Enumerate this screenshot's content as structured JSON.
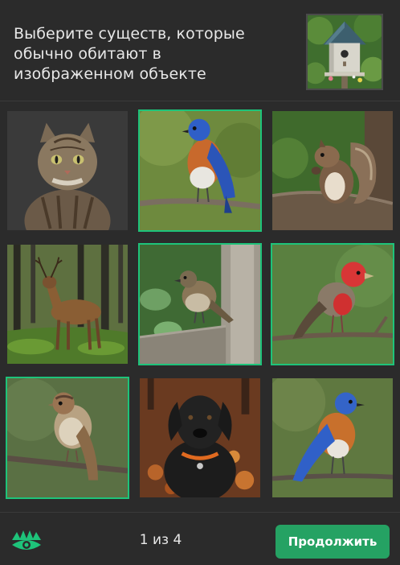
{
  "prompt": {
    "text": "Выберите существ, которые обычно обитают в изображенном объекте"
  },
  "reference_image": {
    "icon": "birdhouse-image"
  },
  "tiles": [
    {
      "subject": "cat",
      "selected": false
    },
    {
      "subject": "bluebird",
      "selected": true
    },
    {
      "subject": "squirrel",
      "selected": false
    },
    {
      "subject": "deer",
      "selected": false
    },
    {
      "subject": "sparrow",
      "selected": true
    },
    {
      "subject": "red-headed-finch",
      "selected": true
    },
    {
      "subject": "sparrow-on-branch",
      "selected": true
    },
    {
      "subject": "black-dog",
      "selected": false
    },
    {
      "subject": "bluebird-2",
      "selected": false
    }
  ],
  "footer": {
    "counter": "1 из 4",
    "continue_label": "Продолжить",
    "logo_icon": "eye-logo-icon"
  },
  "colors": {
    "accent": "#25a263",
    "selected_border": "#1ec37a",
    "background": "#2b2b2b"
  }
}
